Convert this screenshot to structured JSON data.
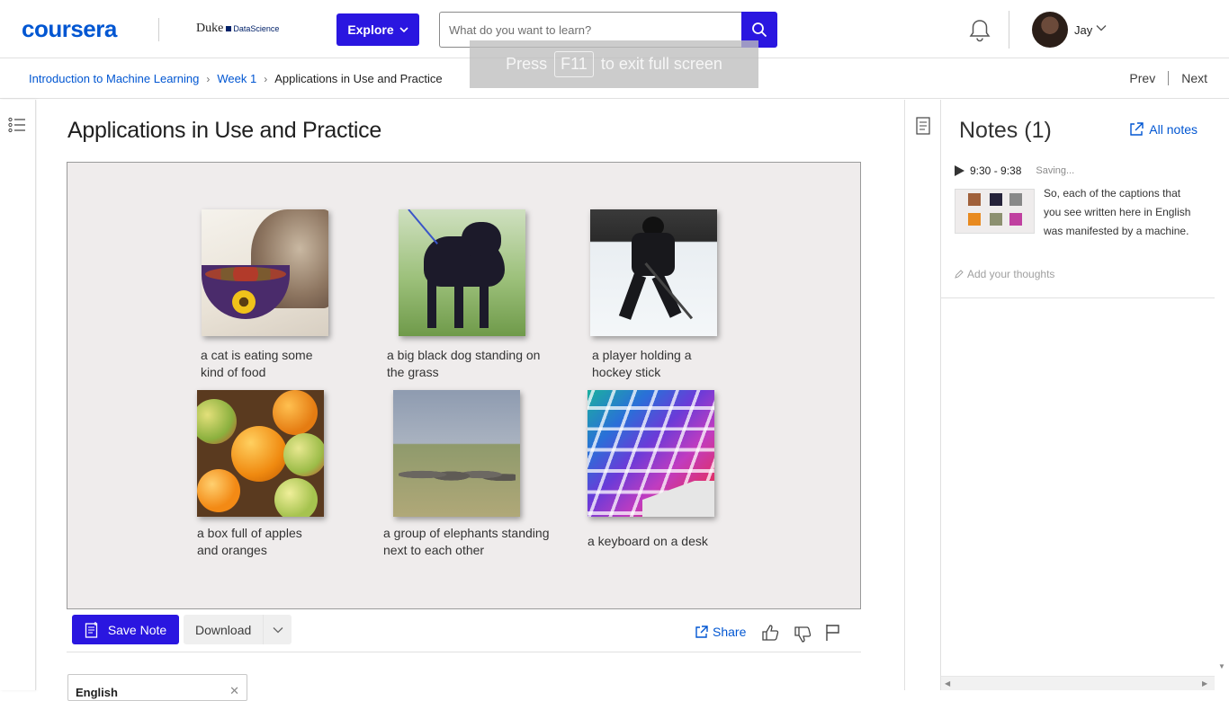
{
  "header": {
    "logo": "coursera",
    "partner_name": "Duke",
    "partner_sub": "DataScience",
    "explore_label": "Explore",
    "search_placeholder": "What do you want to learn?",
    "user_name": "Jay"
  },
  "breadcrumb": {
    "course": "Introduction to Machine Learning",
    "week": "Week 1",
    "current": "Applications in Use and Practice"
  },
  "nav": {
    "prev": "Prev",
    "next": "Next"
  },
  "fullscreen_hint": {
    "before": "Press",
    "key": "F11",
    "after": "to exit full screen"
  },
  "lecture": {
    "title": "Applications in Use and Practice",
    "captions": [
      "a cat is eating some kind of food",
      "a big black dog standing on the grass",
      "a player holding a hockey stick",
      "a box full of apples and oranges",
      "a group of elephants standing next to each other",
      "a keyboard on a desk"
    ]
  },
  "actions": {
    "save_note": "Save Note",
    "download": "Download",
    "share": "Share"
  },
  "language": {
    "selected": "English"
  },
  "notes": {
    "title": "Notes (1)",
    "all_notes": "All notes",
    "entries": [
      {
        "time": "9:30 - 9:38",
        "status": "Saving...",
        "text": "So, each of the captions that you see written here in English was manifested by a machine."
      }
    ],
    "add_thoughts": "Add your thoughts"
  },
  "colors": {
    "brand": "#0056d2",
    "primary_button": "#2a16e0"
  }
}
